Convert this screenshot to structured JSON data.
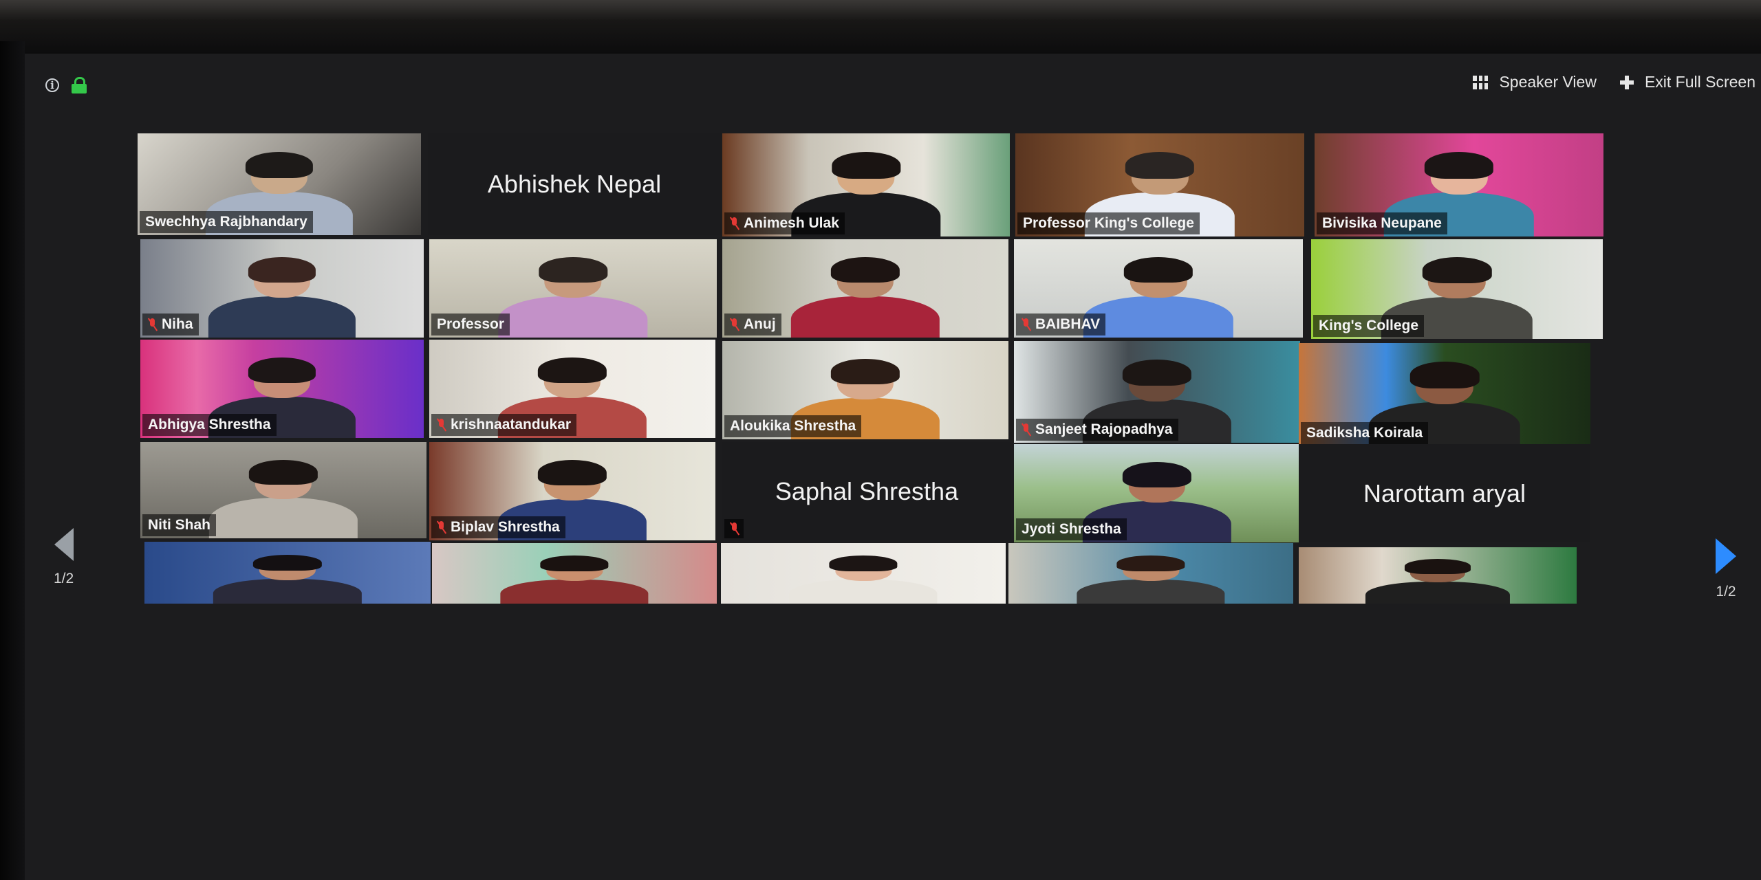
{
  "toolbar": {
    "speaker_view_label": "Speaker View",
    "exit_fullscreen_label": "Exit Full Screen",
    "info_icon": "info-icon",
    "lock_icon": "lock-icon",
    "lock_color": "#34c84a"
  },
  "pagination": {
    "left_label": "1/2",
    "right_label": "1/2",
    "next_arrow_color": "#2d8cff"
  },
  "tiles": [
    {
      "name": "Swechhya Rajbhandary",
      "muted": false,
      "video": true
    },
    {
      "name": "Abhishek Nepal",
      "muted": false,
      "video": false
    },
    {
      "name": "Animesh Ulak",
      "muted": true,
      "video": true
    },
    {
      "name": "Professor King's College",
      "muted": false,
      "video": true
    },
    {
      "name": "Bivisika Neupane",
      "muted": false,
      "video": true
    },
    {
      "name": "Niha",
      "muted": true,
      "video": true
    },
    {
      "name": "Professor",
      "muted": false,
      "video": true
    },
    {
      "name": "Anuj",
      "muted": true,
      "video": true
    },
    {
      "name": "BAIBHAV",
      "muted": true,
      "video": true
    },
    {
      "name": "King's College",
      "muted": false,
      "video": true
    },
    {
      "name": "Abhigya Shrestha",
      "muted": false,
      "video": true
    },
    {
      "name": "krishnaatandukar",
      "muted": true,
      "video": true
    },
    {
      "name": "Aloukika Shrestha",
      "muted": false,
      "video": true
    },
    {
      "name": "Sanjeet Rajopadhya",
      "muted": true,
      "video": true
    },
    {
      "name": "Sadiksha Koirala",
      "muted": false,
      "video": true
    },
    {
      "name": "Niti Shah",
      "muted": false,
      "video": true
    },
    {
      "name": "Biplav Shrestha",
      "muted": true,
      "video": true
    },
    {
      "name": "Saphal Shrestha",
      "muted": true,
      "video": false
    },
    {
      "name": "Jyoti Shrestha",
      "muted": false,
      "video": true
    },
    {
      "name": "Narottam aryal",
      "muted": false,
      "video": false
    },
    {
      "name": "",
      "muted": false,
      "video": true
    },
    {
      "name": "",
      "muted": false,
      "video": true
    },
    {
      "name": "",
      "muted": false,
      "video": true
    },
    {
      "name": "",
      "muted": false,
      "video": true,
      "active_speaker": true
    },
    {
      "name": "",
      "muted": false,
      "video": true
    }
  ],
  "colors": {
    "active_speaker_border": "#c9e63a",
    "muted_mic": "#e53935"
  }
}
